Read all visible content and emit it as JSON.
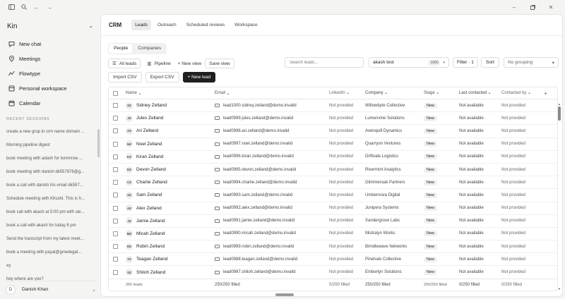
{
  "sidebar": {
    "workspace": "Kin",
    "nav": [
      {
        "label": "New chat",
        "icon": "chat-icon"
      },
      {
        "label": "Meetings",
        "icon": "meetings-icon"
      },
      {
        "label": "Flowtype",
        "icon": "flowtype-icon"
      },
      {
        "label": "Personal workspace",
        "icon": "workspace-icon"
      },
      {
        "label": "Calendar",
        "icon": "calendar-icon"
      }
    ],
    "recent_heading": "RECENT SESSIONS",
    "recent": [
      "create a new grup in crm name domain ...",
      "Morning pipeline digest",
      "book meeting with adash for tommrow ...",
      "book meeting with danish dk557876@g...",
      "book a call with danish his email dk557...",
      "Schedule meeting with Khushi. This is h...",
      "book call with akash at 5:00 pm with sie...",
      "book a call with akash for today 8 pm",
      "Send the transcript from my latest meet...",
      "book a meeting with payal@growlegal...",
      "ey",
      "hey where are you?"
    ],
    "user": {
      "initial": "D",
      "name": "Danish Khan"
    }
  },
  "header": {
    "title": "CRM",
    "tabs": [
      "Leads",
      "Outreach",
      "Scheduled reviews",
      "Workspace"
    ],
    "active_tab": "Leads"
  },
  "subtabs": [
    "People",
    "Companies"
  ],
  "toolbar": {
    "view": "All leads",
    "pipeline": "Pipeline",
    "new_view": "+ New view",
    "save_view": "Save view",
    "search_placeholder": "Search leads...",
    "filter_value": "akash test",
    "filter_count": "1000",
    "filter_label": "Filter · 1",
    "sort_label": "Sort",
    "grouping": "No grouping"
  },
  "actions": {
    "import": "Import CSV",
    "export": "Export CSV",
    "new_lead": "+ New lead"
  },
  "table": {
    "columns": {
      "name": "Name",
      "email": "Email",
      "linkedin": "LinkedIn",
      "company": "Company",
      "stage": "Stage",
      "last_contacted": "Last contacted",
      "contacted_by": "Contacted by"
    },
    "rows": [
      {
        "ini": "SZ",
        "name": "Sidney Zelland",
        "email": "lead1000.sidney.zelland@demo.invalid",
        "linkedin": "Not provided",
        "company": "Willowbyte Collective",
        "stage": "New",
        "last": "Not available",
        "by": "Not provided"
      },
      {
        "ini": "JZ",
        "name": "Jules Zelland",
        "email": "lead0999.jules.zelland@demo.invalid",
        "linkedin": "Not provided",
        "company": "Lumenvine Solutions",
        "stage": "New",
        "last": "Not available",
        "by": "Not provided"
      },
      {
        "ini": "AZ",
        "name": "Ari Zelland",
        "email": "lead0998.ari.zelland@demo.invalid",
        "linkedin": "Not provided",
        "company": "Avenquill Dynamics",
        "stage": "New",
        "last": "Not available",
        "by": "Not provided"
      },
      {
        "ini": "NZ",
        "name": "Noel Zelland",
        "email": "lead0997.noel.zelland@demo.invalid",
        "linkedin": "Not provided",
        "company": "Quarryon Ventures",
        "stage": "New",
        "last": "Not available",
        "by": "Not provided"
      },
      {
        "ini": "KZ",
        "name": "Kiran Zelland",
        "email": "lead0996.kiran.zelland@demo.invalid",
        "linkedin": "Not provided",
        "company": "Driftvale Logistics",
        "stage": "New",
        "last": "Not available",
        "by": "Not provided"
      },
      {
        "ini": "DZ",
        "name": "Devon Zelland",
        "email": "lead0995.devon.zelland@demo.invalid",
        "linkedin": "Not provided",
        "company": "Rivermint Analytics",
        "stage": "New",
        "last": "Not available",
        "by": "Not provided"
      },
      {
        "ini": "CZ",
        "name": "Charlie Zelland",
        "email": "lead0994.charlie.zelland@demo.invalid",
        "linkedin": "Not provided",
        "company": "Glimmeroak Partners",
        "stage": "New",
        "last": "Not available",
        "by": "Not provided"
      },
      {
        "ini": "SZ",
        "name": "Sam Zelland",
        "email": "lead0993.sam.zelland@demo.invalid",
        "linkedin": "Not provided",
        "company": "Umbernova Digital",
        "stage": "New",
        "last": "Not available",
        "by": "Not provided"
      },
      {
        "ini": "AZ",
        "name": "Alex Zelland",
        "email": "lead0992.alex.zelland@demo.invalid",
        "linkedin": "Not provided",
        "company": "Junipera Systems",
        "stage": "New",
        "last": "Not available",
        "by": "Not provided"
      },
      {
        "ini": "JZ",
        "name": "Jamie Zelland",
        "email": "lead0991.jamie.zelland@demo.invalid",
        "linkedin": "Not provided",
        "company": "Xandergrove Labs",
        "stage": "New",
        "last": "Not available",
        "by": "Not provided"
      },
      {
        "ini": "MZ",
        "name": "Micah Zelland",
        "email": "lead0990.micah.zelland@demo.invalid",
        "linkedin": "Not provided",
        "company": "Mistralyn Works",
        "stage": "New",
        "last": "Not available",
        "by": "Not provided"
      },
      {
        "ini": "RZ",
        "name": "Robin Zelland",
        "email": "lead0989.robin.zelland@demo.invalid",
        "linkedin": "Not provided",
        "company": "Brindlewave Networks",
        "stage": "New",
        "last": "Not available",
        "by": "Not provided"
      },
      {
        "ini": "TZ",
        "name": "Teagan Zelland",
        "email": "lead0988.teagan.zelland@demo.invalid",
        "linkedin": "Not provided",
        "company": "Pinehalo Collective",
        "stage": "New",
        "last": "Not available",
        "by": "Not provided"
      },
      {
        "ini": "SZ",
        "name": "Shiloh Zelland",
        "email": "lead0987.shiloh.zelland@demo.invalid",
        "linkedin": "Not provided",
        "company": "Emberlyn Solutions",
        "stage": "New",
        "last": "Not available",
        "by": "Not provided"
      }
    ],
    "footer": {
      "count": "250 leads",
      "email": "250/250 filled",
      "linkedin": "0/250 filled",
      "company": "250/250 filled",
      "stage": "250/250 filled",
      "last": "0/250 filled",
      "by": "0/250 filled"
    }
  }
}
